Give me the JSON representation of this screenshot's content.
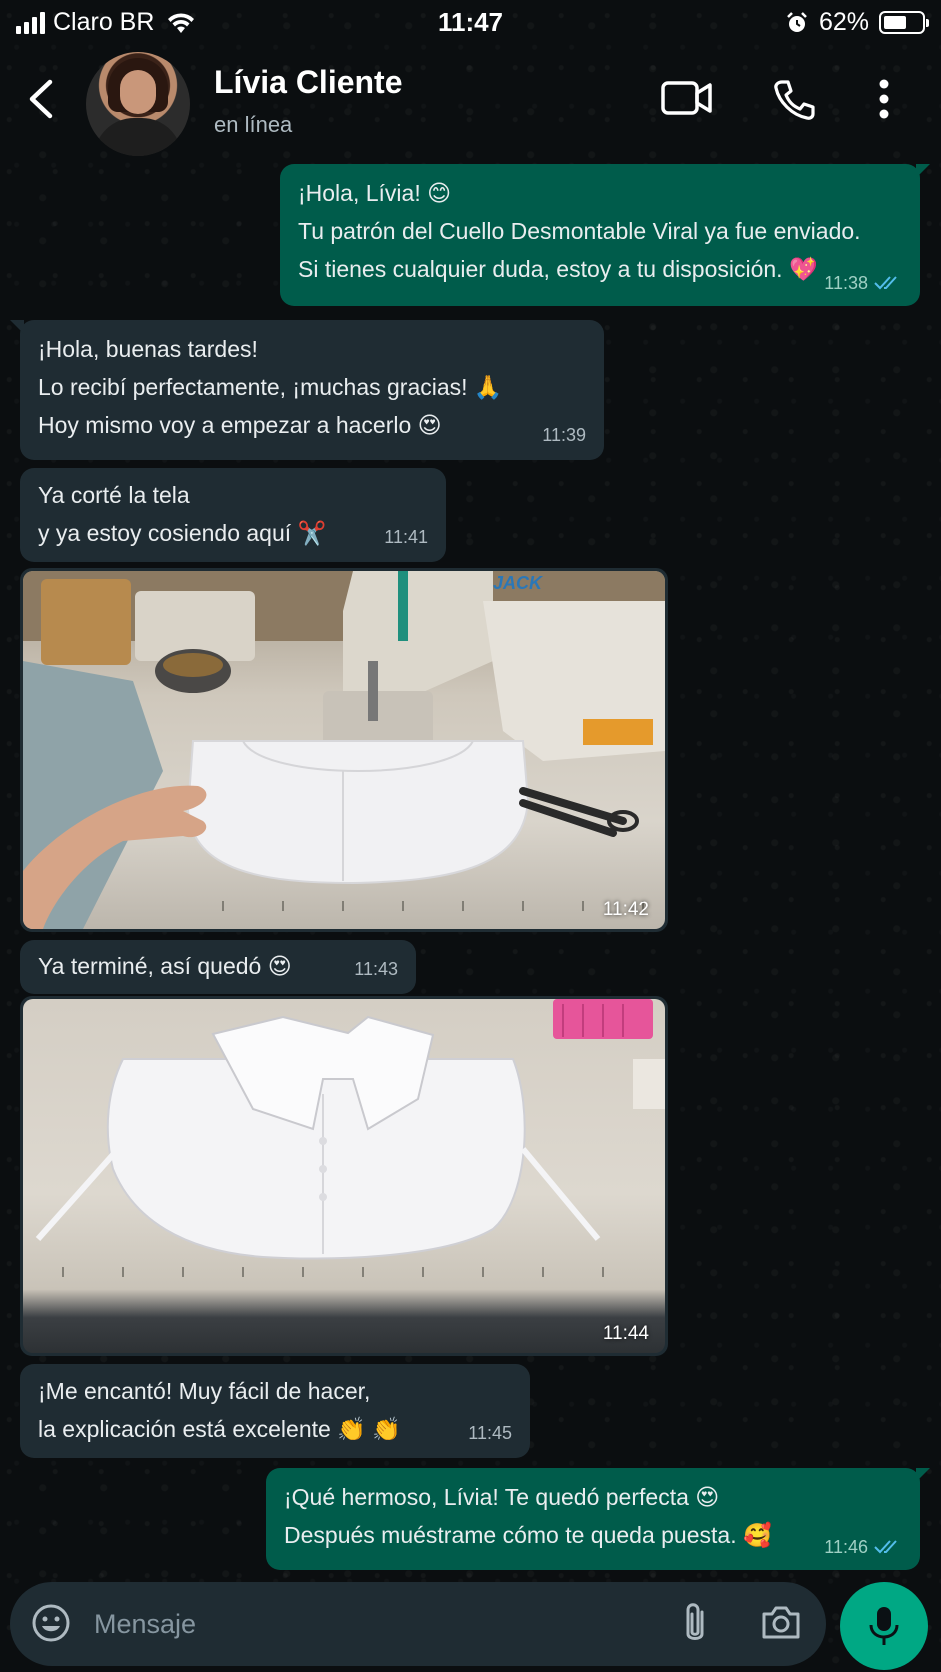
{
  "status_bar": {
    "carrier": "Claro BR",
    "time": "11:47",
    "battery": "62%",
    "battery_level": 0.62,
    "icons": [
      "signal-icon",
      "wifi-icon",
      "alarm-icon",
      "battery-icon"
    ]
  },
  "header": {
    "contact_name": "Lívia Cliente",
    "status": "en línea",
    "icons": [
      "back-arrow-icon",
      "video-call-icon",
      "phone-icon",
      "more-vert-icon"
    ]
  },
  "messages": [
    {
      "direction": "outgoing",
      "lines": [
        "¡Hola, Lívia! 😊",
        "Tu patrón del Cuello Desmontable Viral ya fue enviado.",
        "Si tienes cualquier duda, estoy a tu disposición. 💖"
      ],
      "time": "11:38",
      "read": true
    },
    {
      "direction": "incoming",
      "lines": [
        "¡Hola, buenas tardes!",
        "Lo recibí perfectamente, ¡muchas gracias! 🙏",
        "Hoy mismo voy a empezar a hacerlo 😍"
      ],
      "time": "11:39"
    },
    {
      "direction": "incoming",
      "lines": [
        "Ya corté la tela",
        "y ya estoy cosiendo aquí ✂️"
      ],
      "time": "11:41"
    },
    {
      "direction": "incoming",
      "type": "image",
      "photo_text": "JACK",
      "time": "11:42"
    },
    {
      "direction": "incoming",
      "lines": [
        "Ya terminé, así quedó 😍"
      ],
      "time": "11:43"
    },
    {
      "direction": "incoming",
      "type": "image",
      "time": "11:44"
    },
    {
      "direction": "incoming",
      "lines": [
        "¡Me encantó! Muy fácil de hacer,",
        "la explicación está excelente 👏 👏"
      ],
      "time": "11:45"
    },
    {
      "direction": "outgoing",
      "lines": [
        "¡Qué hermoso, Lívia! Te quedó perfecta 😍",
        "Después muéstrame cómo te queda puesta. 🥰"
      ],
      "time": "11:46",
      "read": true
    }
  ],
  "composer": {
    "placeholder": "Mensaje",
    "icons": [
      "emoji-icon",
      "attach-icon",
      "camera-icon",
      "mic-icon"
    ]
  },
  "colors": {
    "background": "#0b0e10",
    "outgoing_bubble": "#005c4b",
    "incoming_bubble": "#1f2c33",
    "read_ticks": "#53bdeb",
    "accent": "#00a884"
  }
}
